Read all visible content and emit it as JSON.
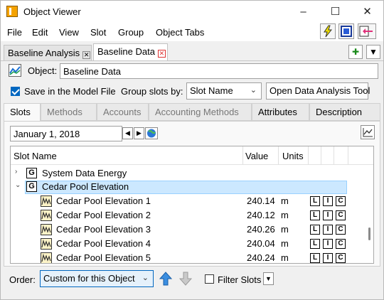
{
  "window": {
    "title": "Object Viewer"
  },
  "window_controls": {
    "minimize": "–",
    "maximize": "☐",
    "close": "✕"
  },
  "menu": [
    "File",
    "Edit",
    "View",
    "Slot",
    "Group",
    "Object Tabs"
  ],
  "doc_tabs": [
    {
      "label": "Baseline Analysis",
      "active": false
    },
    {
      "label": "Baseline Data",
      "active": true
    }
  ],
  "object": {
    "label": "Object:",
    "name": "Baseline Data"
  },
  "options": {
    "save_label": "Save in the Model File",
    "save_checked": true,
    "group_label": "Group slots by:",
    "group_value": "Slot Name",
    "open_button": "Open Data Analysis Tool"
  },
  "tabs": [
    {
      "label": "Slots",
      "state": "active"
    },
    {
      "label": "Methods",
      "state": "disabled"
    },
    {
      "label": "Accounts",
      "state": "disabled"
    },
    {
      "label": "Accounting Methods",
      "state": "disabled"
    },
    {
      "label": "Attributes",
      "state": "enabled"
    },
    {
      "label": "Description",
      "state": "enabled"
    }
  ],
  "date": {
    "value": "January 1, 2018"
  },
  "table": {
    "columns": {
      "name": "Slot Name",
      "value": "Value",
      "units": "Units"
    },
    "groups": [
      {
        "label": "System Data Energy",
        "icon": "G",
        "expanded": false
      },
      {
        "label": "Cedar Pool Elevation",
        "icon": "G",
        "expanded": true
      }
    ],
    "rows": [
      {
        "name": "Cedar Pool Elevation 1",
        "value": "240.14",
        "units": "m"
      },
      {
        "name": "Cedar Pool Elevation 2",
        "value": "240.12",
        "units": "m"
      },
      {
        "name": "Cedar Pool Elevation 3",
        "value": "240.26",
        "units": "m"
      },
      {
        "name": "Cedar Pool Elevation 4",
        "value": "240.04",
        "units": "m"
      },
      {
        "name": "Cedar Pool Elevation 5",
        "value": "240.24",
        "units": "m"
      }
    ],
    "flags": [
      "L",
      "I",
      "C"
    ]
  },
  "bottom": {
    "order_label": "Order:",
    "order_value": "Custom for this Object",
    "filter_label": "Filter Slots",
    "filter_checked": false
  },
  "colors": {
    "accent": "#0067c0",
    "selection": "#cce8ff",
    "selection_border": "#99d1ff"
  }
}
